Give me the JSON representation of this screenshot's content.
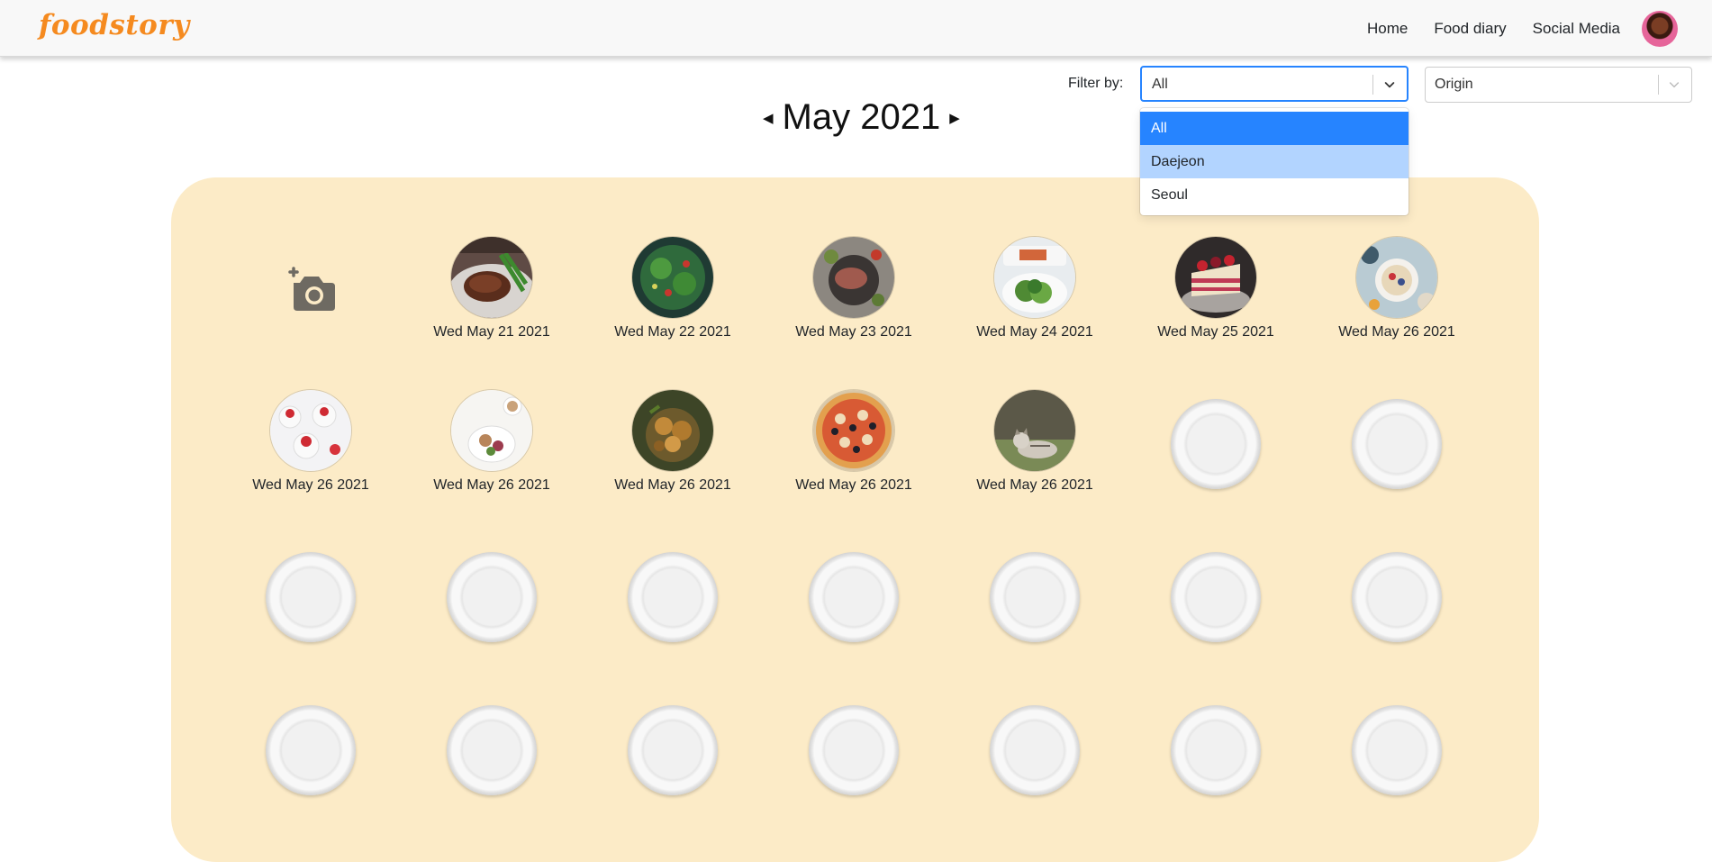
{
  "app": {
    "logo": "foodstory"
  },
  "nav": {
    "home": "Home",
    "food_diary": "Food diary",
    "social_media": "Social Media"
  },
  "filter": {
    "label": "Filter by:",
    "selected": "All",
    "options": [
      "All",
      "Daejeon",
      "Seoul"
    ],
    "origin_placeholder": "Origin"
  },
  "month": {
    "title": "May 2021",
    "prev_icon": "caret-left-icon",
    "next_icon": "caret-right-icon"
  },
  "calendar": {
    "add_icon": "add-photo-icon",
    "entries": [
      {
        "date": "Wed May 21 2021",
        "photo": "steak"
      },
      {
        "date": "Wed May 22 2021",
        "photo": "green-salad"
      },
      {
        "date": "Wed May 23 2021",
        "photo": "meat-plate"
      },
      {
        "date": "Wed May 24 2021",
        "photo": "salad-plates"
      },
      {
        "date": "Wed May 25 2021",
        "photo": "berry-cake"
      },
      {
        "date": "Wed May 26 2021",
        "photo": "breakfast-bowls"
      },
      {
        "date": "Wed May 26 2021",
        "photo": "strawberry-desserts"
      },
      {
        "date": "Wed May 26 2021",
        "photo": "brunch-plate"
      },
      {
        "date": "Wed May 26 2021",
        "photo": "roasted-dish"
      },
      {
        "date": "Wed May 26 2021",
        "photo": "pizza"
      },
      {
        "date": "Wed May 26 2021",
        "photo": "cat"
      }
    ],
    "empty_slots": 16
  },
  "colors": {
    "brand": "#f58a1f",
    "calendar_bg": "#fcebc7",
    "select_focus": "#2684ff",
    "option_focus": "#b2d4ff"
  }
}
